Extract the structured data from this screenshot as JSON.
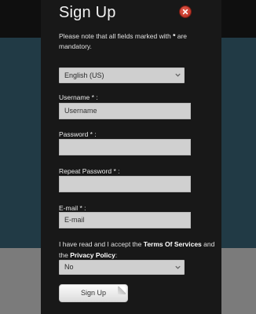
{
  "modal": {
    "title": "Sign Up",
    "note_pre": "Please note that all fields marked with",
    "note_star": "*",
    "note_post": "are mandatory."
  },
  "language_select": {
    "value": "English (US)"
  },
  "fields": {
    "username": {
      "label": "Username * :",
      "placeholder": "Username"
    },
    "password": {
      "label": "Password * :",
      "placeholder": ""
    },
    "repeat_password": {
      "label": "Repeat Password * :",
      "placeholder": ""
    },
    "email": {
      "label": "E-mail * :",
      "placeholder": "E-mail"
    }
  },
  "terms": {
    "pre": "I have read and I accept the",
    "terms_link": "Terms Of Services",
    "mid": "and the",
    "privacy_link": "Privacy Policy",
    "post": ":"
  },
  "privacy_select": {
    "value": "No"
  },
  "buttons": {
    "signup_label": "Sign Up"
  },
  "colors": {
    "modal_bg": "#181818",
    "close_red": "#c9352a",
    "input_bg": "#d0d0d0"
  },
  "icons": {
    "close": "close-icon",
    "dropdown": "chevron-down-icon"
  }
}
